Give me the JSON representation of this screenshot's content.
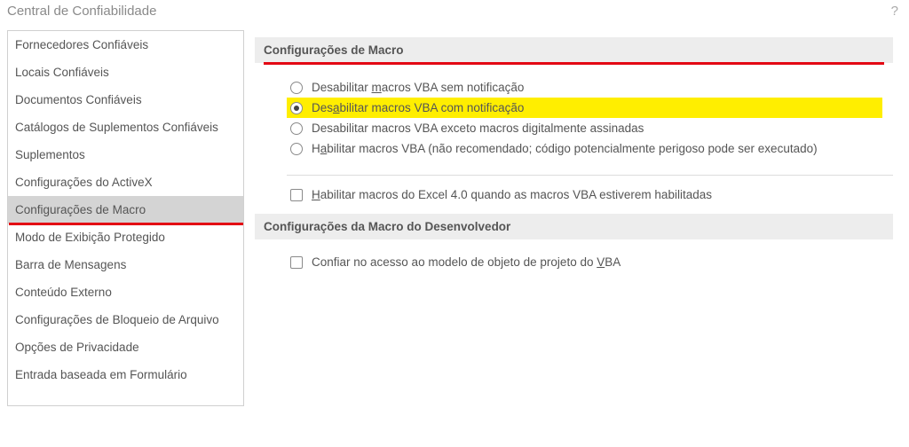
{
  "window": {
    "title": "Central de Confiabilidade",
    "help_symbol": "?"
  },
  "sidebar": {
    "items": [
      {
        "label": "Fornecedores Confiáveis",
        "selected": false,
        "underline": false
      },
      {
        "label": "Locais Confiáveis",
        "selected": false,
        "underline": false
      },
      {
        "label": "Documentos Confiáveis",
        "selected": false,
        "underline": false
      },
      {
        "label": "Catálogos de Suplementos Confiáveis",
        "selected": false,
        "underline": false
      },
      {
        "label": "Suplementos",
        "selected": false,
        "underline": false
      },
      {
        "label": "Configurações do ActiveX",
        "selected": false,
        "underline": false
      },
      {
        "label": "Configurações de Macro",
        "selected": true,
        "underline": true
      },
      {
        "label": "Modo de Exibição Protegido",
        "selected": false,
        "underline": false
      },
      {
        "label": "Barra de Mensagens",
        "selected": false,
        "underline": false
      },
      {
        "label": "Conteúdo Externo",
        "selected": false,
        "underline": false
      },
      {
        "label": "Configurações de Bloqueio de Arquivo",
        "selected": false,
        "underline": false
      },
      {
        "label": "Opções de Privacidade",
        "selected": false,
        "underline": false
      },
      {
        "label": "Entrada baseada em Formulário",
        "selected": false,
        "underline": false
      }
    ]
  },
  "main": {
    "section1": {
      "title": "Configurações de Macro",
      "underline": true,
      "options": [
        {
          "pre": "Desabilitar ",
          "accel": "m",
          "post": "acros VBA sem notificação",
          "selected": false,
          "highlight": false
        },
        {
          "pre": "Des",
          "accel": "a",
          "post": "bilitar macros VBA com notificação",
          "selected": true,
          "highlight": true
        },
        {
          "pre": "Desabilitar macros VBA exceto macros digitalmente assinadas",
          "accel": "",
          "post": "",
          "selected": false,
          "highlight": false
        },
        {
          "pre": "H",
          "accel": "a",
          "post": "bilitar macros VBA (não recomendado; código potencialmente perigoso pode ser executado)",
          "selected": false,
          "highlight": false
        }
      ],
      "excel4": {
        "pre": "",
        "accel": "H",
        "post": "abilitar macros do Excel 4.0 quando as macros VBA estiverem habilitadas",
        "checked": false
      }
    },
    "section2": {
      "title": "Configurações da Macro do Desenvolvedor",
      "trust": {
        "pre": "Confiar no acesso ao modelo de objeto de projeto do ",
        "accel": "V",
        "post": "BA",
        "checked": false
      }
    }
  }
}
